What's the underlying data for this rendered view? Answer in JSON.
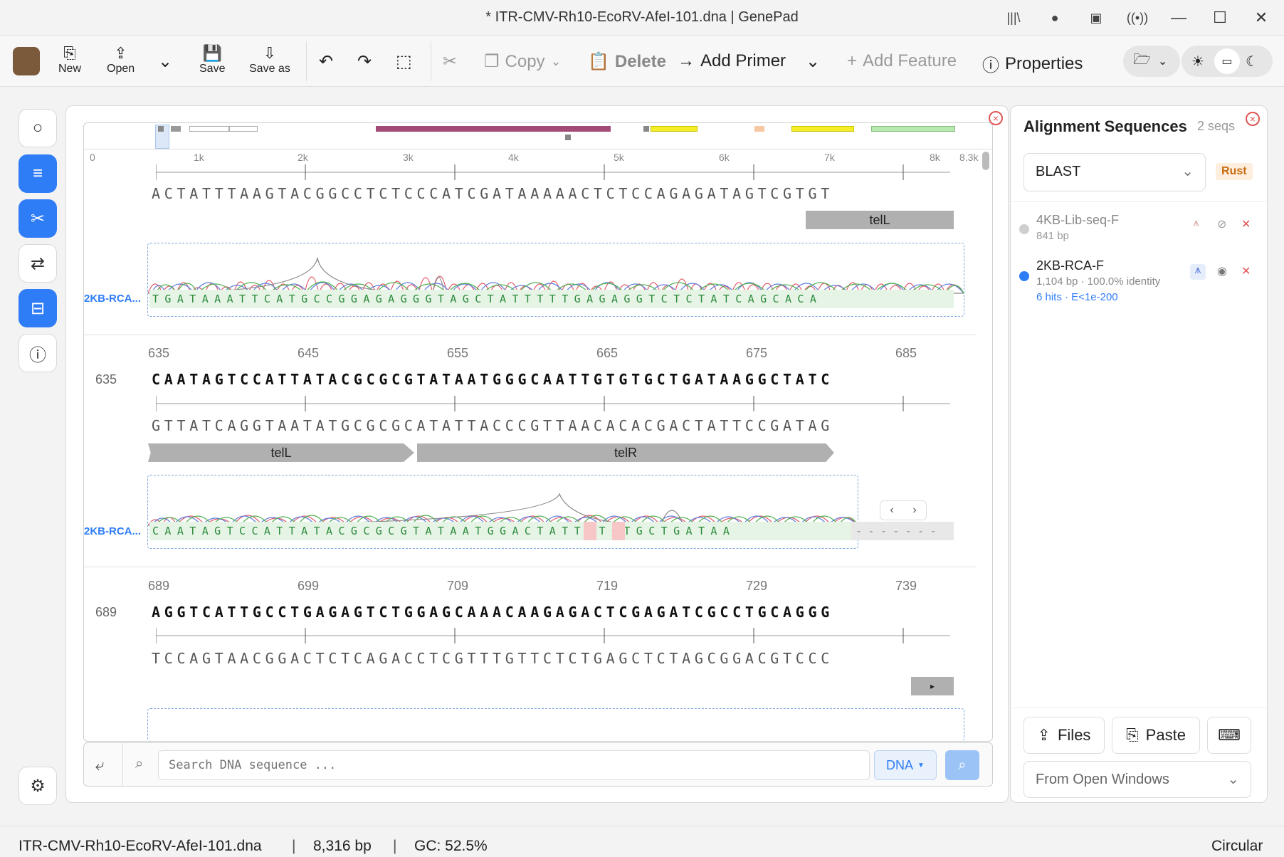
{
  "window": {
    "title": "* ITR-CMV-Rh10-EcoRV-AfeI-101.dna | GenePad"
  },
  "toolbar": {
    "new": "New",
    "open": "Open",
    "save": "Save",
    "save_as": "Save as",
    "copy": "Copy",
    "delete": "Delete",
    "add_primer": "Add Primer",
    "add_feature": "Add Feature",
    "properties": "Properties"
  },
  "ruler": {
    "ticks": [
      "0",
      "1k",
      "2k",
      "3k",
      "4k",
      "5k",
      "6k",
      "7k",
      "8k",
      "8.3k"
    ]
  },
  "rows": [
    {
      "top_seq": "ACTATTTAAGTACGGCCTCTCCCATCGATAAAAACTCTCCAGAGATAGTCGTGT",
      "feature": "telL",
      "trace_label": "2KB-RCA...",
      "trace_seq": "TGATAAATTCATGCCGGAGAGGGTAGCTATTTTTGAGAGGTCTCTATCAGCACA"
    },
    {
      "index": "635",
      "nums": [
        "635",
        "645",
        "655",
        "665",
        "675",
        "685"
      ],
      "top_seq": "CAATAGTCCATTATACGCGCGTATAATGGGCAATTGTGTGCTGATAAGGCTATC",
      "bot_seq": "GTTATCAGGTAATATGCGCGCATATTACCCGTTAACACACGACTATTCCGATAG",
      "features": [
        "telL",
        "telR"
      ],
      "trace_label": "2KB-RCA...",
      "trace_seq": "CAATAGTCCATTATACGCGCGTATAATGGACTATTGTGTGCTGATAA",
      "trace_gap": "-------"
    },
    {
      "index": "689",
      "nums": [
        "689",
        "699",
        "709",
        "719",
        "729",
        "739"
      ],
      "top_seq": "AGGTCATTGCCTGAGAGTCTGGAGCAAACAAGAGACTCGAGATCGCCTGCAGGG",
      "bot_seq": "TCCAGTAACGGACTCTCAGACCTCGTTTGTTCTCTGAGCTCTAGCGGACGTCCC"
    }
  ],
  "search": {
    "placeholder": "Search DNA sequence ...",
    "mode": "DNA"
  },
  "panel": {
    "title": "Alignment Sequences",
    "count": "2 seqs",
    "engine": "BLAST",
    "badge": "Rust",
    "items": [
      {
        "name": "4KB-Lib-seq-F",
        "sub": "841 bp"
      },
      {
        "name": "2KB-RCA-F",
        "sub": "1,104 bp · 100.0% identity",
        "hits": "6 hits · E<1e-200"
      }
    ],
    "files": "Files",
    "paste": "Paste",
    "source": "From Open Windows"
  },
  "status": {
    "file": "ITR-CMV-Rh10-EcoRV-AfeI-101.dna",
    "length": "8,316 bp",
    "gc": "GC: 52.5%",
    "topology": "Circular"
  },
  "colors": {
    "accent": "#2f7df6",
    "feature_magenta": "#a24a78",
    "feature_yellow": "#f5ef2a",
    "feature_green": "#b9e8b0",
    "feature_orange": "#f7c9a3"
  }
}
